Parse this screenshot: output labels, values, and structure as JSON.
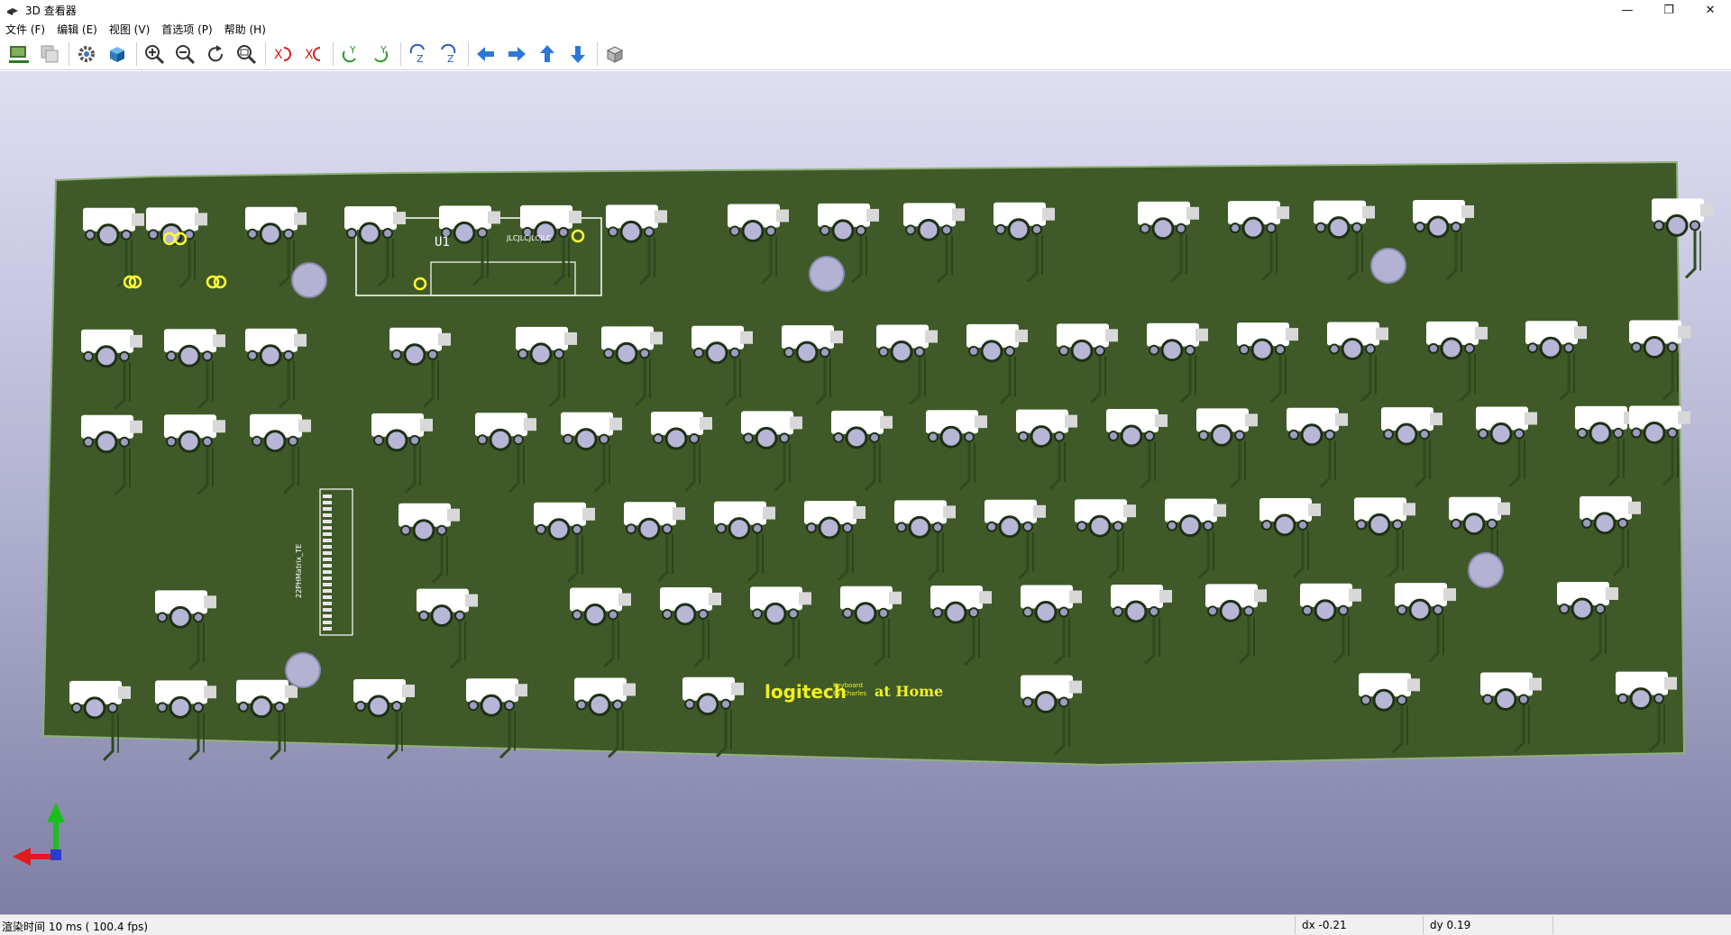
{
  "window": {
    "title": "3D 查看器",
    "minimize": "—",
    "restore": "❐",
    "close": "✕"
  },
  "menu": [
    "文件 (F)",
    "编辑 (E)",
    "视图 (V)",
    "首选项 (P)",
    "帮助 (H)"
  ],
  "toolbar": [
    {
      "name": "export-image-icon"
    },
    {
      "name": "copy-image-icon"
    },
    {
      "name": "sep"
    },
    {
      "name": "settings-icon"
    },
    {
      "name": "raytrace-cube-icon"
    },
    {
      "name": "sep"
    },
    {
      "name": "zoom-in-icon"
    },
    {
      "name": "zoom-out-icon"
    },
    {
      "name": "redraw-icon"
    },
    {
      "name": "zoom-fit-icon"
    },
    {
      "name": "sep"
    },
    {
      "name": "rotate-x-cw-icon"
    },
    {
      "name": "rotate-x-ccw-icon"
    },
    {
      "name": "sep"
    },
    {
      "name": "rotate-y-cw-icon"
    },
    {
      "name": "rotate-y-ccw-icon"
    },
    {
      "name": "sep"
    },
    {
      "name": "rotate-z-cw-icon"
    },
    {
      "name": "rotate-z-ccw-icon"
    },
    {
      "name": "sep"
    },
    {
      "name": "pan-left-icon"
    },
    {
      "name": "pan-right-icon"
    },
    {
      "name": "pan-up-icon"
    },
    {
      "name": "pan-down-icon"
    },
    {
      "name": "sep"
    },
    {
      "name": "ortho-cube-icon"
    }
  ],
  "board": {
    "silkscreen_ref": "U1",
    "silkscreen_tiny": "JLCJLCJLCJLC",
    "connector_label": "22PHMatrix_TE",
    "logo_text": "logitech",
    "logo_small_1": "Keyboard",
    "logo_small_2": "by Charles",
    "logo_suffix": "at Home",
    "colors": {
      "pcb": "#3f5a28",
      "trace": "#2f4a1f",
      "pad": "#ffffff",
      "silk": "#ffff33"
    }
  },
  "status": {
    "render_time": "渲染时间 10 ms ( 100.4 fps)",
    "dx": "dx -0.21",
    "dy": "dy 0.19"
  }
}
